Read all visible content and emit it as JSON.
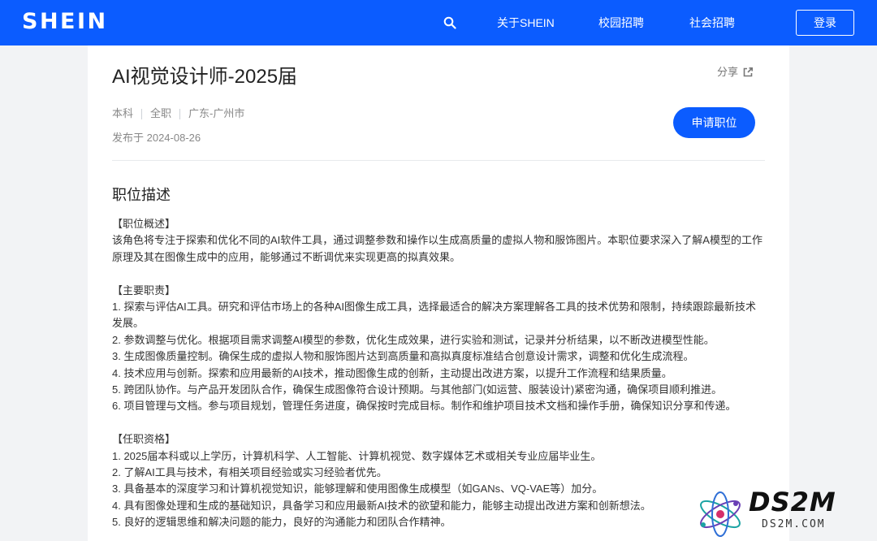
{
  "header": {
    "logo": "SHEIN",
    "nav": {
      "about": "关于SHEIN",
      "campus": "校园招聘",
      "social": "社会招聘"
    },
    "login": "登录",
    "search_icon": "search-icon"
  },
  "job": {
    "title": "AI视觉设计师-2025届",
    "share": "分享",
    "education": "本科",
    "type": "全职",
    "location": "广东-广州市",
    "posted": "发布于 2024-08-26",
    "apply": "申请职位"
  },
  "description": {
    "title": "职位描述",
    "lines": [
      "【职位概述】",
      "该角色将专注于探索和优化不同的AI软件工具，通过调整参数和操作以生成高质量的虚拟人物和服饰图片。本职位要求深入了解A模型的工作原理及其在图像生成中的应用，能够通过不断调优来实现更高的拟真效果。",
      "",
      "【主要职责】",
      "1. 探索与评估AI工具。研究和评估市场上的各种AI图像生成工具，选择最适合的解决方案理解各工具的技术优势和限制，持续跟踪最新技术发展。",
      "2. 参数调整与优化。根据项目需求调整AI模型的参数，优化生成效果，进行实验和测试，记录并分析结果，以不断改进模型性能。",
      "3. 生成图像质量控制。确保生成的虚拟人物和服饰图片达到高质量和高拟真度标准结合创意设计需求，调整和优化生成流程。",
      "4. 技术应用与创新。探索和应用最新的AI技术，推动图像生成的创新，主动提出改进方案，以提升工作流程和结果质量。",
      "5. 跨团队协作。与产品开发团队合作，确保生成图像符合设计预期。与其他部门(如运营、服装设计)紧密沟通，确保项目顺利推进。",
      "6. 项目管理与文档。参与项目规划，管理任务进度，确保按时完成目标。制作和维护项目技术文档和操作手册，确保知识分享和传递。",
      "",
      "【任职资格】",
      "1. 2025届本科或以上学历，计算机科学、人工智能、计算机视觉、数字媒体艺术或相关专业应届毕业生。",
      "2. 了解AI工具与技术，有相关项目经验或实习经验者优先。",
      "3. 具备基本的深度学习和计算机视觉知识，能够理解和使用图像生成模型（如GANs、VQ-VAE等）加分。",
      "4. 具有图像处理和生成的基础知识，具备学习和应用最新AI技术的欲望和能力，能够主动提出改进方案和创新想法。",
      "5. 良好的逻辑思维和解决问题的能力，良好的沟通能力和团队合作精神。"
    ]
  },
  "watermark": {
    "text": "DS2M",
    "sub": "DS2M.COM"
  }
}
